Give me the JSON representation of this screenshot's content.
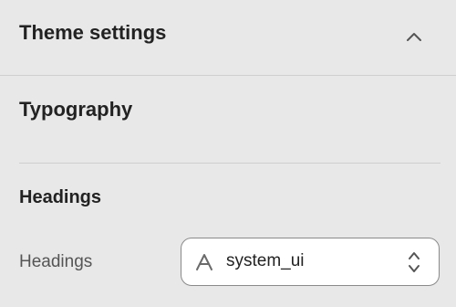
{
  "header": {
    "title": "Theme settings"
  },
  "section": {
    "title": "Typography",
    "expanded": true,
    "toggle_icon": "chevron-up-icon"
  },
  "headings_group": {
    "title": "Headings",
    "font_field": {
      "label": "Headings",
      "value": "system_ui",
      "leading_icon": "font-icon",
      "trailing_icon": "select-updown-icon"
    }
  },
  "colors": {
    "background": "#e8e8e8",
    "text": "#222222",
    "muted_text": "#555555",
    "border": "#8a8a8a",
    "divider": "#cfcfcf",
    "input_background": "#ffffff"
  }
}
